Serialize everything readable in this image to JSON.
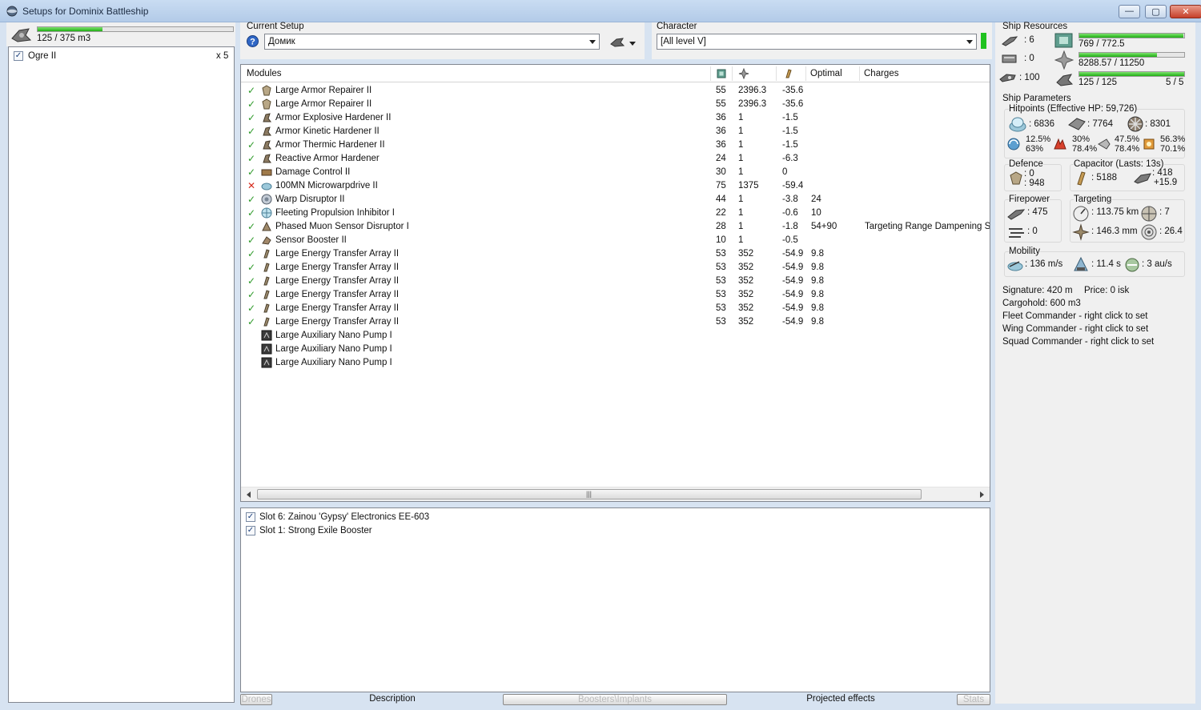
{
  "window": {
    "title": "Setups for Dominix Battleship",
    "minimize": "—",
    "maximize": "▢",
    "close": "✕"
  },
  "drones": {
    "bandwidth_text": "125 / 375 m3",
    "bandwidth_fraction": 0.333,
    "items": [
      {
        "name": "Ogre II",
        "count": "x 5",
        "checked": true
      }
    ]
  },
  "setup": {
    "label": "Current Setup",
    "value": "Домик"
  },
  "character": {
    "label": "Character",
    "value": "[All level V]"
  },
  "modules": {
    "columns": {
      "name": "Modules",
      "optimal": "Optimal",
      "charges": "Charges"
    },
    "rows": [
      {
        "status": "ok",
        "name": "Large Armor Repairer II",
        "cpu": "55",
        "pg": "2396.3",
        "cap": "-35.6",
        "optimal": "",
        "charges": "",
        "icon": "repair"
      },
      {
        "status": "ok",
        "name": "Large Armor Repairer II",
        "cpu": "55",
        "pg": "2396.3",
        "cap": "-35.6",
        "optimal": "",
        "charges": "",
        "icon": "repair"
      },
      {
        "status": "ok",
        "name": "Armor Explosive Hardener II",
        "cpu": "36",
        "pg": "1",
        "cap": "-1.5",
        "optimal": "",
        "charges": "",
        "icon": "hardener"
      },
      {
        "status": "ok",
        "name": "Armor Kinetic Hardener II",
        "cpu": "36",
        "pg": "1",
        "cap": "-1.5",
        "optimal": "",
        "charges": "",
        "icon": "hardener"
      },
      {
        "status": "ok",
        "name": "Armor Thermic Hardener II",
        "cpu": "36",
        "pg": "1",
        "cap": "-1.5",
        "optimal": "",
        "charges": "",
        "icon": "hardener"
      },
      {
        "status": "ok",
        "name": "Reactive Armor Hardener",
        "cpu": "24",
        "pg": "1",
        "cap": "-6.3",
        "optimal": "",
        "charges": "",
        "icon": "hardener"
      },
      {
        "status": "ok",
        "name": "Damage Control II",
        "cpu": "30",
        "pg": "1",
        "cap": "0",
        "optimal": "",
        "charges": "",
        "icon": "damage-control"
      },
      {
        "status": "bad",
        "name": "100MN Microwarpdrive II",
        "cpu": "75",
        "pg": "1375",
        "cap": "-59.4",
        "optimal": "",
        "charges": "",
        "icon": "mwd"
      },
      {
        "status": "ok",
        "name": "Warp Disruptor II",
        "cpu": "44",
        "pg": "1",
        "cap": "-3.8",
        "optimal": "24",
        "charges": "",
        "icon": "disruptor"
      },
      {
        "status": "ok",
        "name": "Fleeting Propulsion Inhibitor I",
        "cpu": "22",
        "pg": "1",
        "cap": "-0.6",
        "optimal": "10",
        "charges": "",
        "icon": "web"
      },
      {
        "status": "ok",
        "name": "Phased Muon Sensor Disruptor I",
        "cpu": "28",
        "pg": "1",
        "cap": "-1.8",
        "optimal": "54+90",
        "charges": "Targeting Range Dampening Scr",
        "icon": "damp"
      },
      {
        "status": "ok",
        "name": "Sensor Booster II",
        "cpu": "10",
        "pg": "1",
        "cap": "-0.5",
        "optimal": "",
        "charges": "",
        "icon": "sensor"
      },
      {
        "status": "ok",
        "name": "Large Energy Transfer Array II",
        "cpu": "53",
        "pg": "352",
        "cap": "-54.9",
        "optimal": "9.8",
        "charges": "",
        "icon": "energy"
      },
      {
        "status": "ok",
        "name": "Large Energy Transfer Array II",
        "cpu": "53",
        "pg": "352",
        "cap": "-54.9",
        "optimal": "9.8",
        "charges": "",
        "icon": "energy"
      },
      {
        "status": "ok",
        "name": "Large Energy Transfer Array II",
        "cpu": "53",
        "pg": "352",
        "cap": "-54.9",
        "optimal": "9.8",
        "charges": "",
        "icon": "energy"
      },
      {
        "status": "ok",
        "name": "Large Energy Transfer Array II",
        "cpu": "53",
        "pg": "352",
        "cap": "-54.9",
        "optimal": "9.8",
        "charges": "",
        "icon": "energy"
      },
      {
        "status": "ok",
        "name": "Large Energy Transfer Array II",
        "cpu": "53",
        "pg": "352",
        "cap": "-54.9",
        "optimal": "9.8",
        "charges": "",
        "icon": "energy"
      },
      {
        "status": "ok",
        "name": "Large Energy Transfer Array II",
        "cpu": "53",
        "pg": "352",
        "cap": "-54.9",
        "optimal": "9.8",
        "charges": "",
        "icon": "energy"
      },
      {
        "status": "",
        "name": "Large Auxiliary Nano Pump I",
        "cpu": "",
        "pg": "",
        "cap": "",
        "optimal": "",
        "charges": "",
        "icon": "rig"
      },
      {
        "status": "",
        "name": "Large Auxiliary Nano Pump I",
        "cpu": "",
        "pg": "",
        "cap": "",
        "optimal": "",
        "charges": "",
        "icon": "rig"
      },
      {
        "status": "",
        "name": "Large Auxiliary Nano Pump I",
        "cpu": "",
        "pg": "",
        "cap": "",
        "optimal": "",
        "charges": "",
        "icon": "rig"
      }
    ]
  },
  "boosters": [
    {
      "label": "Slot 6: Zainou 'Gypsy' Electronics EE-603",
      "checked": true
    },
    {
      "label": "Slot 1: Strong Exile Booster",
      "checked": true
    }
  ],
  "tabs": [
    "Drones",
    "Description",
    "Boosters\\Implants",
    "Projected effects",
    "Stats"
  ],
  "resources": {
    "title": "Ship Resources",
    "turrets": ": 6",
    "launchers": ": 0",
    "calibration": ": 100",
    "cpu": "769 / 772.5",
    "cpu_fraction": 0.995,
    "pg": "8288.57 / 11250",
    "pg_fraction": 0.737,
    "drone_bw": "125 / 125",
    "drone_count": "5 / 5",
    "drone_fraction": 1.0
  },
  "params": {
    "title": "Ship Parameters",
    "hp_title": "Hitpoints (Effective HP: 59,726)",
    "shield_hp": ": 6836",
    "armor_hp": ": 7764",
    "structure_hp": ": 8301",
    "resist": [
      {
        "top": "12.5%",
        "bottom": "63%"
      },
      {
        "top": "30%",
        "bottom": "78.4%"
      },
      {
        "top": "47.5%",
        "bottom": "78.4%"
      },
      {
        "top": "56.3%",
        "bottom": "70.1%"
      }
    ],
    "defence_title": "Defence",
    "defence_a": ": 0",
    "defence_b": ": 948",
    "capacitor_title": "Capacitor (Lasts: 13s)",
    "cap_amount": ": 5188",
    "cap_a": ": 418",
    "cap_b": "+15.9",
    "firepower_title": "Firepower",
    "fp_a": ": 475",
    "fp_b": ": 0",
    "targeting_title": "Targeting",
    "tg_range": ": 113.75 km",
    "tg_targets": ": 7",
    "tg_res": ": 146.3 mm",
    "tg_sens": ": 26.4",
    "mobility_title": "Mobility",
    "speed": ": 136 m/s",
    "align": ": 11.4 s",
    "warp": ": 3 au/s",
    "signature": "Signature: 420 m",
    "price": "Price: 0 isk",
    "cargo": "Cargohold: 600 m3",
    "fleet_cmd": "Fleet Commander - right click to set",
    "wing_cmd": "Wing Commander - right click to set",
    "squad_cmd": "Squad Commander - right click to set"
  }
}
